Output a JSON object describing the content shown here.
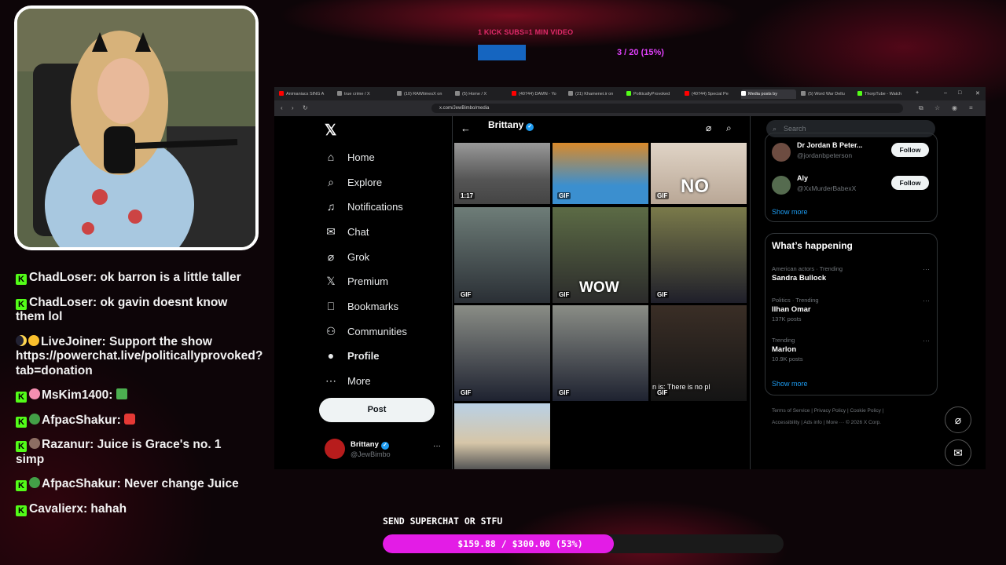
{
  "stream_overlay": {
    "goal_title": "1 KICK SUBS=1 MIN VIDEO",
    "goal_count": "3 / 20 (15%)",
    "goal_fraction": 0.15,
    "donation_label": "SEND SUPERCHAT OR STFU",
    "donation_text": "$159.88 / $300.00 (53%)",
    "donation_fraction": 0.53,
    "accent_color": "#e31ce6"
  },
  "chat": [
    {
      "badge": "K",
      "user": "ChadLoser:",
      "text": "ok barron is a little taller"
    },
    {
      "badge": "K",
      "user": "ChadLoser:",
      "text": "ok gavin doesnt know them lol"
    },
    {
      "badge": "moon-coin",
      "user": "LiveJoiner:",
      "text": "Support the show https://powerchat.live/politicallyprovoked?tab=donation"
    },
    {
      "badge": "K",
      "user": "MsKim1400:",
      "text": ""
    },
    {
      "badge": "K",
      "user": "AfpacShakur:",
      "text": ""
    },
    {
      "badge": "K",
      "user": "Razanur:",
      "text": "Juice is Grace's no. 1 simp"
    },
    {
      "badge": "K",
      "user": "AfpacShakur:",
      "text": "Never change Juice"
    },
    {
      "badge": "K",
      "user": "Cavalierx:",
      "text": "hahah"
    }
  ],
  "browser": {
    "tabs": [
      {
        "label": "Animaniacs SING A",
        "color": "#ff0000"
      },
      {
        "label": "true crime / X",
        "color": "#ffffff"
      },
      {
        "label": "(10) RAWtimesX on",
        "color": "#ffffff"
      },
      {
        "label": "(5) Home / X",
        "color": "#ffffff"
      },
      {
        "label": "(40744) DAMN - Yo",
        "color": "#ff0000"
      },
      {
        "label": "(21) Khamenei.ir on",
        "color": "#ffffff"
      },
      {
        "label": "PoliticallyProvoked",
        "color": "#53fc18"
      },
      {
        "label": "(40744) Special Pe",
        "color": "#ff0000"
      },
      {
        "label": "Media posts by",
        "color": "#ffffff"
      },
      {
        "label": "(5) Word War Dellu",
        "color": "#ffffff"
      },
      {
        "label": "ThorpTube - Watch",
        "color": "#53fc18"
      }
    ],
    "url": "x.com/JewBimbo/media"
  },
  "x_nav": {
    "items": [
      {
        "label": "Home",
        "icon": "home-icon"
      },
      {
        "label": "Explore",
        "icon": "search-icon"
      },
      {
        "label": "Notifications",
        "icon": "bell-icon"
      },
      {
        "label": "Chat",
        "icon": "mail-icon"
      },
      {
        "label": "Grok",
        "icon": "grok-icon"
      },
      {
        "label": "Premium",
        "icon": "x-icon"
      },
      {
        "label": "Bookmarks",
        "icon": "bookmark-icon"
      },
      {
        "label": "Communities",
        "icon": "people-icon"
      },
      {
        "label": "Profile",
        "icon": "person-icon"
      },
      {
        "label": "More",
        "icon": "more-circle-icon"
      }
    ],
    "post_label": "Post",
    "account": {
      "name": "Brittany",
      "handle": "@JewBimbo",
      "menu": "···"
    }
  },
  "profile_header": {
    "name": "Brittany"
  },
  "media_grid": [
    {
      "tag": "1:17",
      "overlay": ""
    },
    {
      "tag": "GIF",
      "overlay": ""
    },
    {
      "tag": "GIF",
      "overlay": "NO"
    },
    {
      "tag": "GIF",
      "overlay": ""
    },
    {
      "tag": "GIF",
      "overlay": "WOW"
    },
    {
      "tag": "GIF",
      "overlay": ""
    },
    {
      "tag": "GIF",
      "overlay": ""
    },
    {
      "tag": "GIF",
      "overlay": ""
    },
    {
      "tag": "GIF",
      "overlay": "n is: There is no pl"
    },
    {
      "tag": "",
      "overlay": ""
    }
  ],
  "right_column": {
    "search_placeholder": "Search",
    "who_to_follow": [
      {
        "name": "Dr Jordan B Peter...",
        "handle": "@jordanbpeterson",
        "button": "Follow"
      },
      {
        "name": "Aly",
        "handle": "@XxMurderBabexX",
        "button": "Follow"
      }
    ],
    "show_more_1": "Show more",
    "whats_happening_title": "What’s happening",
    "trends": [
      {
        "context": "American actors · Trending",
        "name": "Sandra Bullock",
        "posts": ""
      },
      {
        "context": "Politics · Trending",
        "name": "Ilhan Omar",
        "posts": "137K posts"
      },
      {
        "context": "Trending",
        "name": "Marlon",
        "posts": "10.9K posts"
      }
    ],
    "show_more_2": "Show more",
    "footer_line1": "Terms of Service  |  Privacy Policy  |  Cookie Policy  |",
    "footer_line2": "Accessibility  |  Ads info  |  More ···  © 2026 X Corp."
  }
}
